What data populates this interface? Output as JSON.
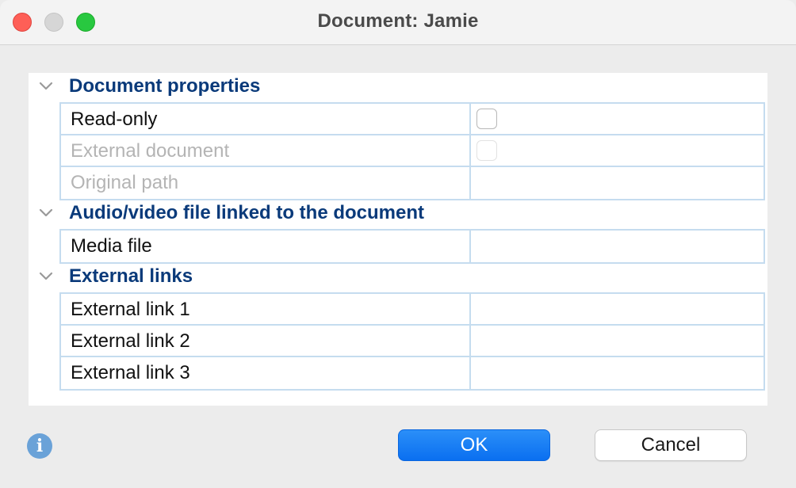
{
  "window": {
    "title": "Document:  Jamie"
  },
  "sections": {
    "properties": {
      "title": "Document properties",
      "rows": {
        "read_only": {
          "label": "Read-only",
          "checked": false,
          "enabled": true
        },
        "external_document": {
          "label": "External document",
          "checked": false,
          "enabled": false
        },
        "original_path": {
          "label": "Original path",
          "value": "",
          "enabled": false
        }
      }
    },
    "media": {
      "title": "Audio/video file linked to the document",
      "rows": {
        "media_file": {
          "label": "Media file",
          "value": ""
        }
      }
    },
    "links": {
      "title": "External links",
      "rows": {
        "link1": {
          "label": "External link 1",
          "value": ""
        },
        "link2": {
          "label": "External link 2",
          "value": ""
        },
        "link3": {
          "label": "External link 3",
          "value": ""
        }
      }
    }
  },
  "footer": {
    "info_glyph": "i",
    "ok_label": "OK",
    "cancel_label": "Cancel"
  },
  "colors": {
    "section_title": "#0a3a7a",
    "grid_border": "#c5dcef",
    "ok_button": "#0a6ff0",
    "info_icon": "#6aa2d8",
    "close": "#fe5f57",
    "minimize": "#d6d6d6",
    "maximize": "#28c840"
  }
}
